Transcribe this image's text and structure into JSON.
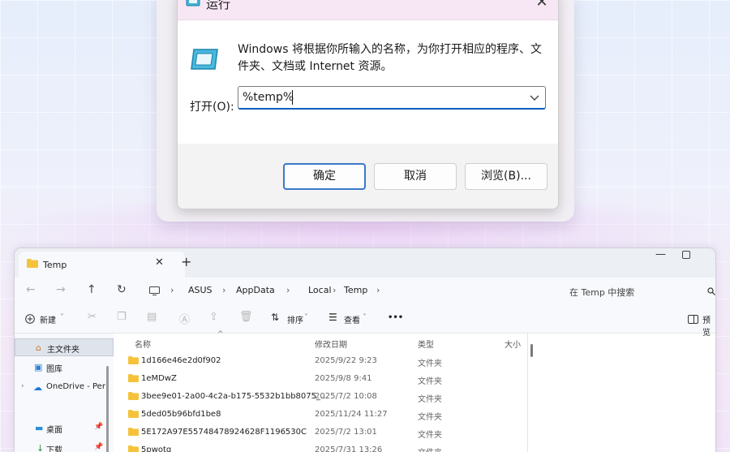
{
  "run": {
    "title": "运行",
    "description": "Windows 将根据你所输入的名称，为你打开相应的程序、文件夹、文档或 Internet 资源。",
    "open_label": "打开(O):",
    "input_value": "%temp%",
    "buttons": {
      "ok": "确定",
      "cancel": "取消",
      "browse": "浏览(B)..."
    },
    "close_glyph": "✕"
  },
  "explorer": {
    "tab": {
      "label": "Temp",
      "close": "✕",
      "add": "+"
    },
    "window": {
      "minimize": "—"
    },
    "nav": {
      "back": "←",
      "forward": "→",
      "up": "↑",
      "refresh": "↻"
    },
    "breadcrumb": [
      "ASUS",
      "AppData",
      "Local",
      "Temp"
    ],
    "search_placeholder": "在 Temp 中搜索",
    "toolbar": {
      "new": "新建",
      "sort": "排序",
      "view": "查看",
      "more": "•••",
      "preview": "预览"
    },
    "sidebar": [
      {
        "label": "主文件夹",
        "icon": "home-icon",
        "selected": true
      },
      {
        "label": "图库",
        "icon": "gallery-icon",
        "selected": false
      },
      {
        "label": "OneDrive - Per",
        "icon": "cloud-icon",
        "selected": false
      },
      {
        "label": "桌面",
        "icon": "desktop-icon",
        "selected": false
      },
      {
        "label": "下载",
        "icon": "download-icon",
        "selected": false
      }
    ],
    "columns": {
      "name": "名称",
      "modified": "修改日期",
      "type": "类型",
      "size": "大小"
    },
    "files": [
      {
        "name": "1d166e46e2d0f902",
        "modified": "2025/9/22 9:23",
        "type": "文件夹"
      },
      {
        "name": "1eMDwZ",
        "modified": "2025/9/8 9:41",
        "type": "文件夹"
      },
      {
        "name": "3bee9e01-2a00-4c2a-b175-5532b1bb8075_...",
        "modified": "2025/7/2 10:08",
        "type": "文件夹"
      },
      {
        "name": "5ded05b96bfd1be8",
        "modified": "2025/11/24 11:27",
        "type": "文件夹"
      },
      {
        "name": "5E172A97E55748478924628F1196530C",
        "modified": "2025/7/2 13:01",
        "type": "文件夹"
      },
      {
        "name": "5pwotq",
        "modified": "2025/7/31 13:26",
        "type": "文件夹"
      }
    ]
  }
}
